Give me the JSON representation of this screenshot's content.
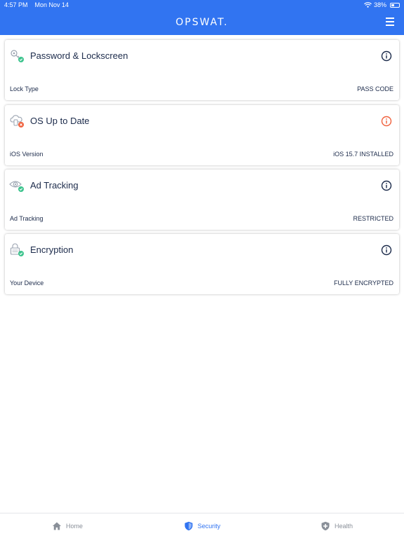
{
  "status_bar": {
    "time": "4:57 PM",
    "date": "Mon Nov 14",
    "battery_percent": "38%",
    "battery_level": 0.38,
    "wifi_icon": "wifi-icon",
    "battery_icon": "battery-icon"
  },
  "header": {
    "logo": "OPSWAT.",
    "menu_icon": "hamburger-menu-icon"
  },
  "cards": [
    {
      "title": "Password & Lockscreen",
      "label": "Lock Type",
      "value": "PASS CODE",
      "status": "ok",
      "icon": "key-icon"
    },
    {
      "title": "OS Up to Date",
      "label": "iOS Version",
      "value": "iOS 15.7 INSTALLED",
      "status": "warning",
      "icon": "cloud-device-icon"
    },
    {
      "title": "Ad Tracking",
      "label": "Ad Tracking",
      "value": "RESTRICTED",
      "status": "ok",
      "icon": "eye-icon"
    },
    {
      "title": "Encryption",
      "label": "Your Device",
      "value": "FULLY ENCRYPTED",
      "status": "ok",
      "icon": "lock-icon"
    }
  ],
  "tabs": [
    {
      "label": "Home",
      "icon": "home-icon",
      "active": false
    },
    {
      "label": "Security",
      "icon": "shield-icon",
      "active": true
    },
    {
      "label": "Health",
      "icon": "health-shield-icon",
      "active": false
    }
  ],
  "colors": {
    "brand_blue": "#3174f1",
    "ok_green": "#3ec48e",
    "warning_red": "#f0603c",
    "text_dark": "#1b2a4a",
    "tab_inactive": "#8a9099"
  }
}
